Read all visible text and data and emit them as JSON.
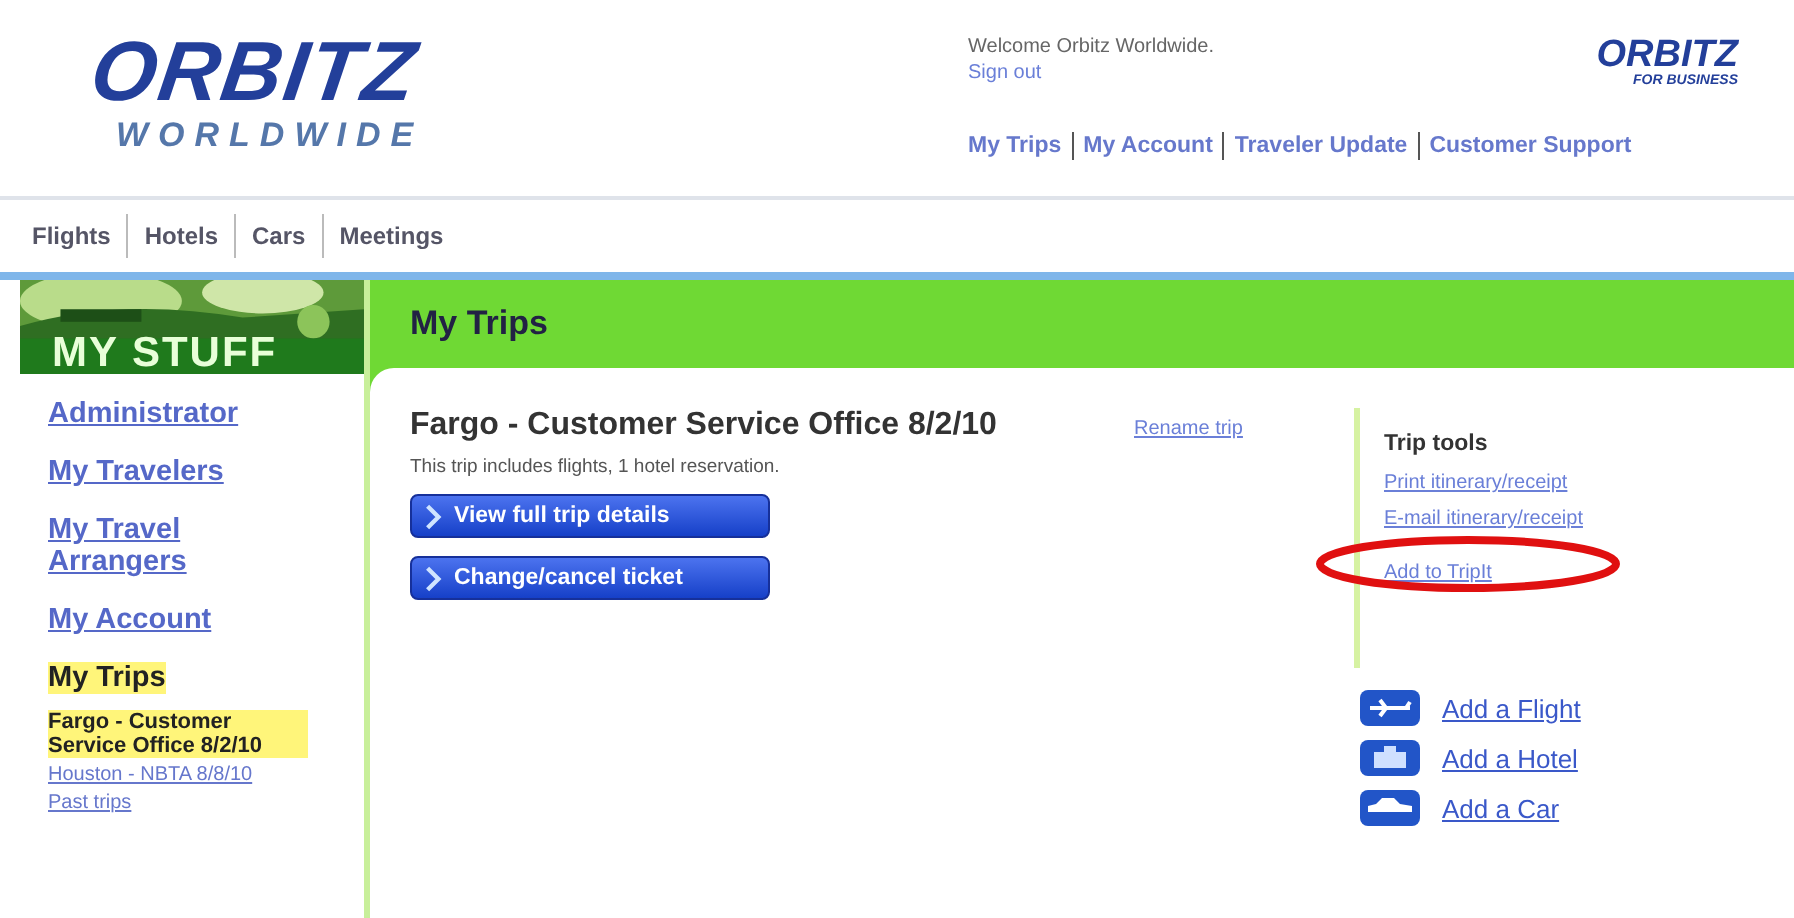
{
  "logo": {
    "name": "ORBITZ",
    "tagline": "WORLDWIDE"
  },
  "welcome": {
    "text": "Welcome Orbitz Worldwide.",
    "link": "Sign out"
  },
  "business_logo": {
    "name": "ORBITZ",
    "tagline": "FOR BUSINESS"
  },
  "top_links": [
    "My Trips",
    "My Account",
    "Traveler Update",
    "Customer Support"
  ],
  "tabs": [
    "Flights",
    "Hotels",
    "Cars",
    "Meetings"
  ],
  "sidebar": {
    "title": "MY STUFF",
    "items": [
      {
        "label": "Administrator",
        "selected": false
      },
      {
        "label": "My Travelers",
        "selected": false
      },
      {
        "label": "My Travel Arrangers",
        "selected": false
      },
      {
        "label": "My Account",
        "selected": false
      },
      {
        "label": "My Trips",
        "selected": true
      }
    ],
    "trips": [
      {
        "label": "Fargo - Customer Service Office 8/2/10",
        "selected": true
      },
      {
        "label": "Houston - NBTA 8/8/10",
        "selected": false
      },
      {
        "label": "Past trips",
        "selected": false
      }
    ]
  },
  "page_title": "My Trips",
  "trip": {
    "title": "Fargo - Customer Service Office 8/2/10",
    "rename": "Rename trip",
    "summary": "This trip includes flights, 1 hotel reservation.",
    "buttons": [
      "View full trip details",
      "Change/cancel ticket"
    ]
  },
  "trip_tools": {
    "title": "Trip tools",
    "links": [
      {
        "label": "Print itinerary/receipt",
        "circled": false
      },
      {
        "label": "E-mail itinerary/receipt",
        "circled": false
      },
      {
        "label": "Add to TripIt",
        "circled": true
      }
    ]
  },
  "add_links": [
    {
      "kind": "flight",
      "label": "Add a Flight"
    },
    {
      "kind": "hotel",
      "label": "Add a Hotel"
    },
    {
      "kind": "car",
      "label": "Add a Car"
    }
  ]
}
